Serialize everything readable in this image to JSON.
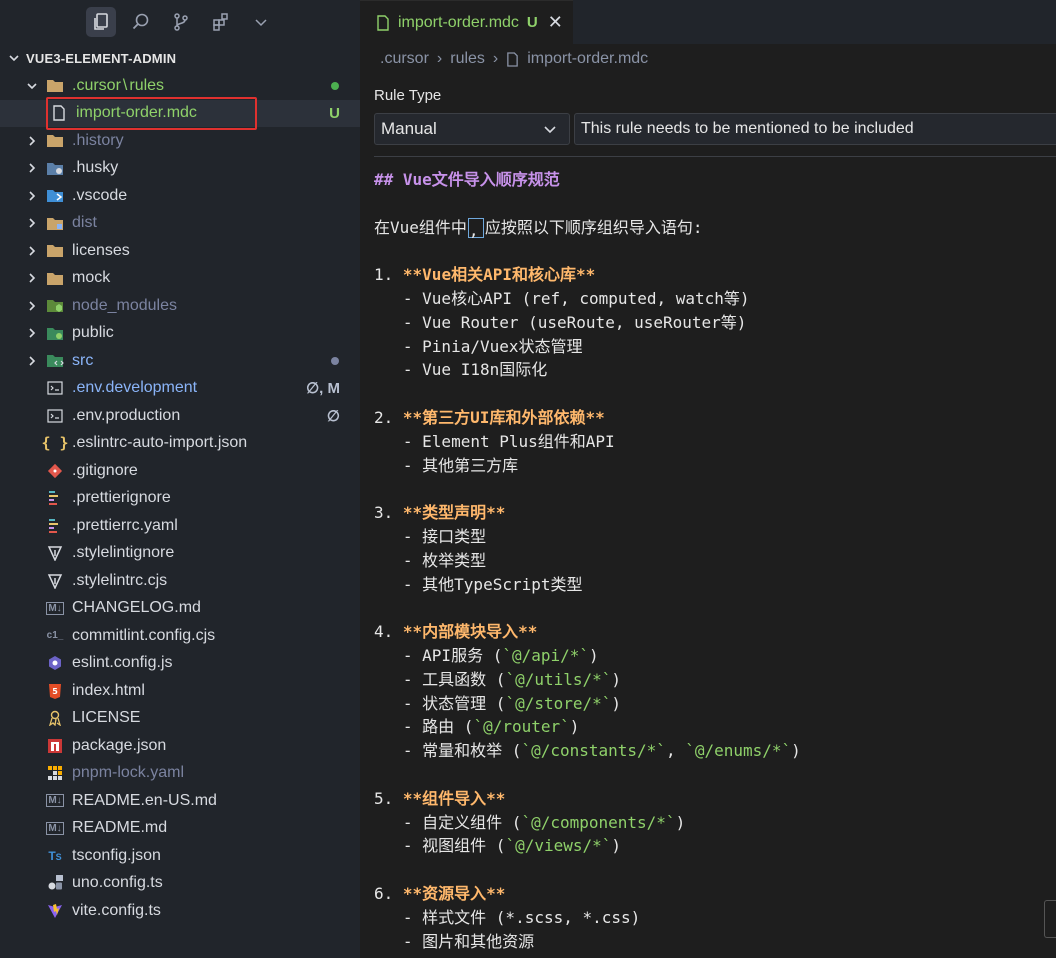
{
  "explorer": {
    "title": "VUE3-ELEMENT-ADMIN"
  },
  "tree": [
    {
      "kind": "folder",
      "label": ".cursor",
      "extra": "rules",
      "indent": 1,
      "open": true,
      "color": "green",
      "icon": "folder-icon",
      "dot": "#4caf50"
    },
    {
      "kind": "file",
      "label": "import-order.mdc",
      "indent": 2,
      "color": "green",
      "icon": "file-icon",
      "badge": "U",
      "badgeColor": "#8fd16a",
      "selected": true
    },
    {
      "kind": "folder",
      "label": ".history",
      "indent": 1,
      "color": "dim",
      "icon": "folder-icon"
    },
    {
      "kind": "folder",
      "label": ".husky",
      "indent": 1,
      "color": "",
      "icon": "husky-folder-icon"
    },
    {
      "kind": "folder",
      "label": ".vscode",
      "indent": 1,
      "color": "",
      "icon": "vscode-folder-icon"
    },
    {
      "kind": "folder",
      "label": "dist",
      "indent": 1,
      "color": "dim",
      "icon": "dist-folder-icon"
    },
    {
      "kind": "folder",
      "label": "licenses",
      "indent": 1,
      "color": "",
      "icon": "folder-icon"
    },
    {
      "kind": "folder",
      "label": "mock",
      "indent": 1,
      "color": "",
      "icon": "folder-icon"
    },
    {
      "kind": "folder",
      "label": "node_modules",
      "indent": 1,
      "color": "dim",
      "icon": "node-folder-icon"
    },
    {
      "kind": "folder",
      "label": "public",
      "indent": 1,
      "color": "",
      "icon": "public-folder-icon"
    },
    {
      "kind": "folder",
      "label": "src",
      "indent": 1,
      "color": "blue",
      "icon": "src-folder-icon",
      "dot": "#7b83a0"
    },
    {
      "kind": "file",
      "label": ".env.development",
      "indent": 1,
      "color": "blue",
      "icon": "terminal-file-icon",
      "badge": "∅, M",
      "badgeColor": "#b8c0d0"
    },
    {
      "kind": "file",
      "label": ".env.production",
      "indent": 1,
      "color": "",
      "icon": "terminal-file-icon",
      "badge": "∅",
      "badgeColor": "#b8c0d0"
    },
    {
      "kind": "file",
      "label": ".eslintrc-auto-import.json",
      "indent": 1,
      "color": "",
      "icon": "json-braces-icon"
    },
    {
      "kind": "file",
      "label": ".gitignore",
      "indent": 1,
      "color": "",
      "icon": "git-icon"
    },
    {
      "kind": "file",
      "label": ".prettierignore",
      "indent": 1,
      "color": "",
      "icon": "prettier-icon"
    },
    {
      "kind": "file",
      "label": ".prettierrc.yaml",
      "indent": 1,
      "color": "",
      "icon": "prettier-icon"
    },
    {
      "kind": "file",
      "label": ".stylelintignore",
      "indent": 1,
      "color": "",
      "icon": "stylelint-icon"
    },
    {
      "kind": "file",
      "label": ".stylelintrc.cjs",
      "indent": 1,
      "color": "",
      "icon": "stylelint-icon"
    },
    {
      "kind": "file",
      "label": "CHANGELOG.md",
      "indent": 1,
      "color": "",
      "icon": "markdown-icon"
    },
    {
      "kind": "file",
      "label": "commitlint.config.cjs",
      "indent": 1,
      "color": "",
      "icon": "commitlint-icon"
    },
    {
      "kind": "file",
      "label": "eslint.config.js",
      "indent": 1,
      "color": "",
      "icon": "eslint-icon"
    },
    {
      "kind": "file",
      "label": "index.html",
      "indent": 1,
      "color": "",
      "icon": "html5-icon"
    },
    {
      "kind": "file",
      "label": "LICENSE",
      "indent": 1,
      "color": "",
      "icon": "license-icon"
    },
    {
      "kind": "file",
      "label": "package.json",
      "indent": 1,
      "color": "",
      "icon": "npm-icon"
    },
    {
      "kind": "file",
      "label": "pnpm-lock.yaml",
      "indent": 1,
      "color": "dim",
      "icon": "pnpm-icon"
    },
    {
      "kind": "file",
      "label": "README.en-US.md",
      "indent": 1,
      "color": "",
      "icon": "markdown-icon"
    },
    {
      "kind": "file",
      "label": "README.md",
      "indent": 1,
      "color": "",
      "icon": "markdown-icon"
    },
    {
      "kind": "file",
      "label": "tsconfig.json",
      "indent": 1,
      "color": "",
      "icon": "tsconfig-icon"
    },
    {
      "kind": "file",
      "label": "uno.config.ts",
      "indent": 1,
      "color": "",
      "icon": "unocss-icon"
    },
    {
      "kind": "file",
      "label": "vite.config.ts",
      "indent": 1,
      "color": "",
      "icon": "vite-icon"
    }
  ],
  "tab": {
    "name": "import-order.mdc",
    "status": "U",
    "close": "✕"
  },
  "breadcrumb": {
    "seg1": ".cursor",
    "seg2": "rules",
    "seg3": "import-order.mdc"
  },
  "rule": {
    "label": "Rule Type",
    "selected": "Manual",
    "description": "This rule needs to be mentioned to be included"
  },
  "doc": {
    "heading": "## Vue文件导入顺序规范",
    "intro_a": "在Vue组件中",
    "intro_b": "应按照以下顺序组织导入语句:",
    "s1_num": "1. ",
    "s1_title": "**Vue相关API和核心库**",
    "s1_l1": "   - Vue核心API (ref, computed, watch等)",
    "s1_l2": "   - Vue Router (useRoute, useRouter等)",
    "s1_l3": "   - Pinia/Vuex状态管理",
    "s1_l4": "   - Vue I18n国际化",
    "s2_num": "2. ",
    "s2_title": "**第三方UI库和外部依赖**",
    "s2_l1": "   - Element Plus组件和API",
    "s2_l2": "   - 其他第三方库",
    "s3_num": "3. ",
    "s3_title": "**类型声明**",
    "s3_l1": "   - 接口类型",
    "s3_l2": "   - 枚举类型",
    "s3_l3": "   - 其他TypeScript类型",
    "s4_num": "4. ",
    "s4_title": "**内部模块导入**",
    "s4_l1_a": "   - API服务 (",
    "s4_l1_c": "`@/api/*`",
    "s4_l1_b": ")",
    "s4_l2_a": "   - 工具函数 (",
    "s4_l2_c": "`@/utils/*`",
    "s4_l2_b": ")",
    "s4_l3_a": "   - 状态管理 (",
    "s4_l3_c": "`@/store/*`",
    "s4_l3_b": ")",
    "s4_l4_a": "   - 路由 (",
    "s4_l4_c": "`@/router`",
    "s4_l4_b": ")",
    "s4_l5_a": "   - 常量和枚举 (",
    "s4_l5_c1": "`@/constants/*`",
    "s4_l5_m": ", ",
    "s4_l5_c2": "`@/enums/*`",
    "s4_l5_b": ")",
    "s5_num": "5. ",
    "s5_title": "**组件导入**",
    "s5_l1_a": "   - 自定义组件 (",
    "s5_l1_c": "`@/components/*`",
    "s5_l1_b": ")",
    "s5_l2_a": "   - 视图组件 (",
    "s5_l2_c": "`@/views/*`",
    "s5_l2_b": ")",
    "s6_num": "6. ",
    "s6_title": "**资源导入**",
    "s6_l1": "   - 样式文件 (*.scss, *.css)",
    "s6_l2": "   - 图片和其他资源"
  }
}
